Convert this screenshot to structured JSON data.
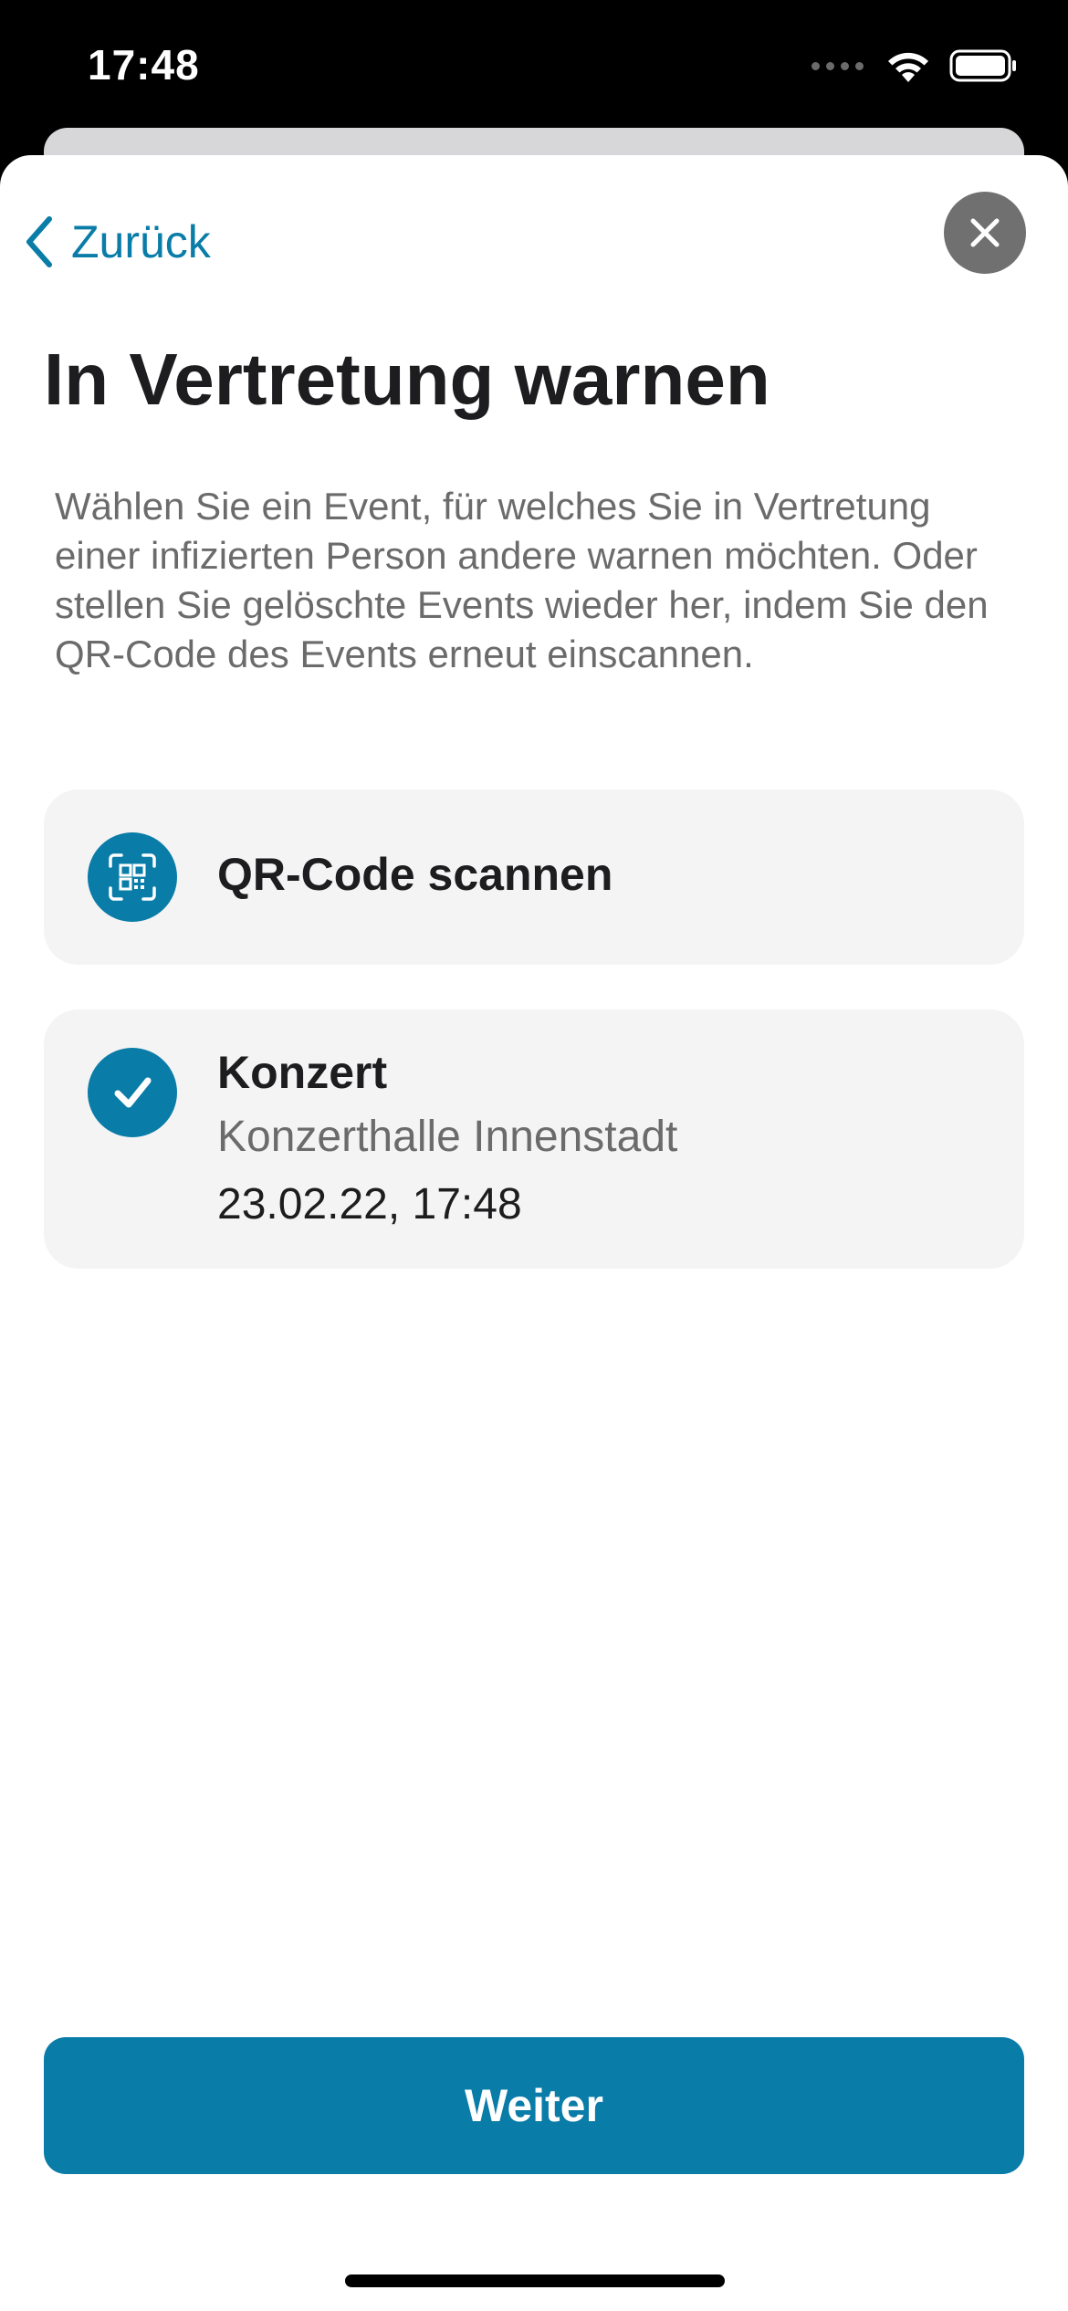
{
  "status_bar": {
    "time": "17:48"
  },
  "navigation": {
    "back_label": "Zurück"
  },
  "page": {
    "title": "In Vertretung warnen",
    "description": "Wählen Sie ein Event, für welches Sie in Vertretung einer infizierten Person andere warnen möchten. Oder stellen Sie gelöschte Events wieder her, indem Sie den QR-Code des Events erneut einscannen."
  },
  "scan_card": {
    "label": "QR-Code scannen"
  },
  "event": {
    "name": "Konzert",
    "location": "Konzerthalle Innenstadt",
    "datetime": "23.02.22, 17:48",
    "selected": true
  },
  "footer": {
    "continue_label": "Weiter"
  },
  "colors": {
    "accent": "#0a7ca8",
    "card_background": "#f4f4f4",
    "close_button": "#707070"
  }
}
